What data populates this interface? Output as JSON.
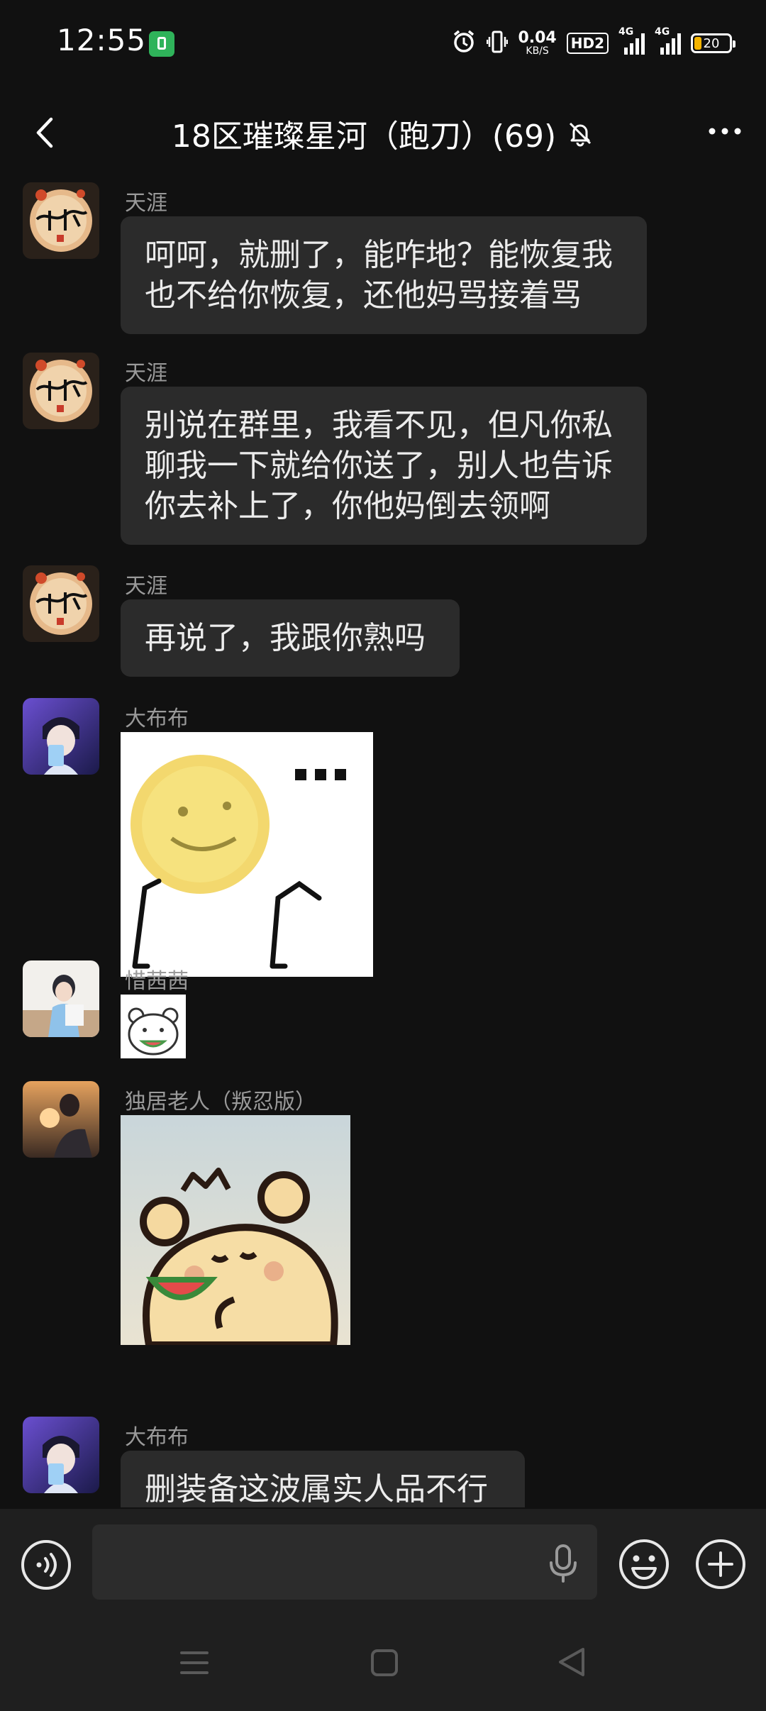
{
  "status_bar": {
    "time": "12:55",
    "net_speed_value": "0.04",
    "net_speed_unit": "KB/S",
    "hd_label": "HD2",
    "signal1_label": "4G",
    "signal2_label": "4G",
    "battery_percent": "20",
    "battery_color": "#f5b400"
  },
  "header": {
    "title": "18区璀璨星河（跑刀）(69)",
    "icons": [
      "back-icon",
      "mute-bell-icon",
      "more-icon"
    ]
  },
  "messages": [
    {
      "sender": "天涯",
      "type": "text",
      "text": "呵呵，就删了，能咋地？能恢复我也不给你恢复，还他妈骂接着骂"
    },
    {
      "sender": "天涯",
      "type": "text",
      "text": "别说在群里，我看不见，但凡你私聊我一下就给你送了，别人也告诉你去补上了，你他妈倒去领啊"
    },
    {
      "sender": "天涯",
      "type": "text",
      "text": "再说了，我跟你熟吗"
    },
    {
      "sender": "大布布",
      "type": "sticker",
      "sticker": "smiley-ellipsis-sticker"
    },
    {
      "sender": "惜茜茜",
      "type": "sticker",
      "sticker": "white-bear-watermelon-sticker"
    },
    {
      "sender": "独居老人（叛忍版）",
      "type": "sticker",
      "sticker": "yellow-bear-watermelon-sticker"
    },
    {
      "sender": "大布布",
      "type": "text",
      "text": "删装备这波属实人品不行"
    }
  ],
  "input_bar": {
    "placeholder": "",
    "icons": [
      "voice-icon",
      "mic-icon",
      "emoji-icon",
      "plus-icon"
    ]
  },
  "colors": {
    "background": "#111111",
    "bubble": "#2b2b2b",
    "sender_name": "#9a9a9a",
    "bar": "#1f1f1f"
  }
}
